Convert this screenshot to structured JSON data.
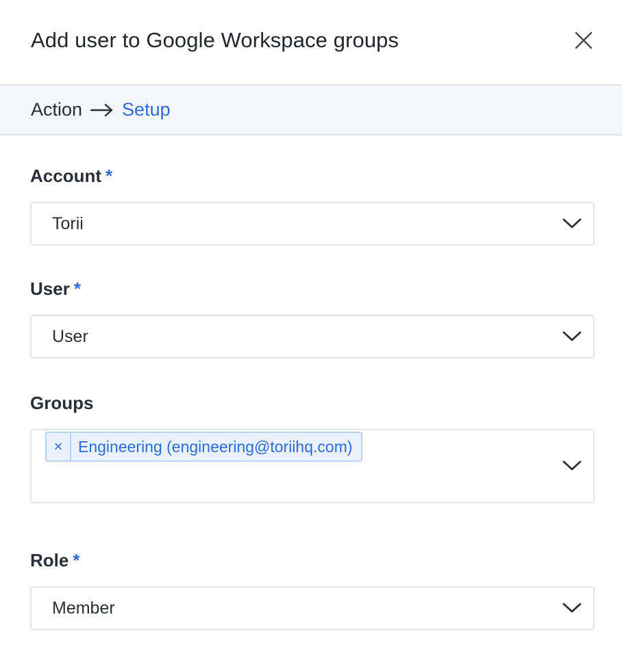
{
  "header": {
    "title": "Add user to Google Workspace groups",
    "close_icon": "close-icon"
  },
  "breadcrumb": {
    "step1": "Action",
    "arrow_icon": "arrow-right-icon",
    "step2": "Setup"
  },
  "form": {
    "required_marker": "*",
    "account": {
      "label": "Account",
      "required": true,
      "value": "Torii"
    },
    "user": {
      "label": "User",
      "required": true,
      "value": "User"
    },
    "groups": {
      "label": "Groups",
      "required": false,
      "tags": [
        {
          "remove_glyph": "×",
          "label": "Engineering (engineering@toriihq.com)"
        }
      ]
    },
    "role": {
      "label": "Role",
      "required": true,
      "value": "Member"
    }
  },
  "colors": {
    "accent": "#2f6bd8",
    "breadcrumb_bg": "#f3f6fb",
    "border": "#e1e4ea",
    "tag_bg": "#e9f1fd",
    "tag_border": "#b9d1f3"
  }
}
